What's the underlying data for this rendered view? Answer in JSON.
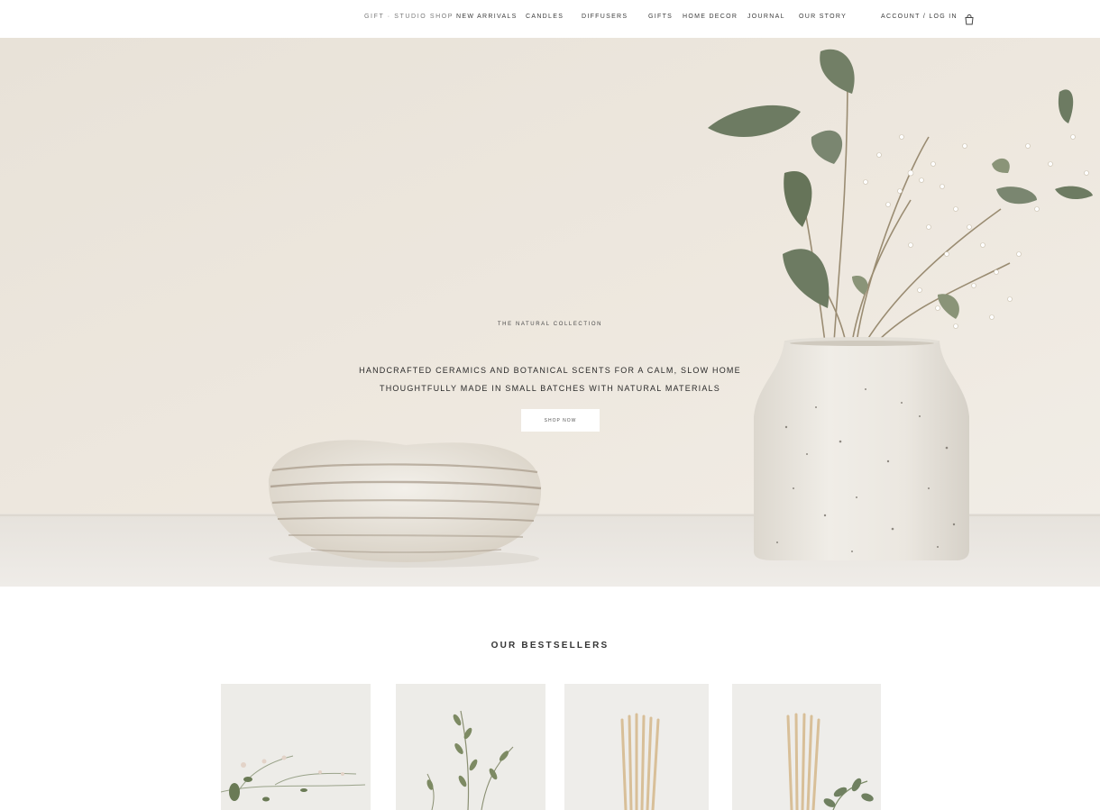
{
  "header": {
    "logo": "GIFT · STUDIO SHOP",
    "nav": [
      "NEW ARRIVALS",
      "CANDLES",
      "DIFFUSERS",
      "GIFTS",
      "HOME DECOR",
      "JOURNAL",
      "OUR STORY"
    ],
    "account": "ACCOUNT / LOG IN",
    "icons": {
      "cart": "shopping-bag-icon"
    }
  },
  "hero": {
    "eyebrow": "THE NATURAL COLLECTION",
    "line1": "HANDCRAFTED CERAMICS AND BOTANICAL SCENTS FOR A CALM, SLOW HOME",
    "line2": "THOUGHTFULLY MADE IN SMALL BATCHES WITH NATURAL MATERIALS",
    "button": "SHOP NOW"
  },
  "collection": {
    "title": "OUR BESTSELLERS",
    "cards": [
      "card-1",
      "card-2",
      "card-3",
      "card-4"
    ]
  },
  "colors": {
    "hero_wall": "#ece6dc",
    "table": "#eae7e2",
    "foliage": "#6d7b62",
    "vase": "#ece9e2",
    "accent_text": "#2a2a2a"
  }
}
